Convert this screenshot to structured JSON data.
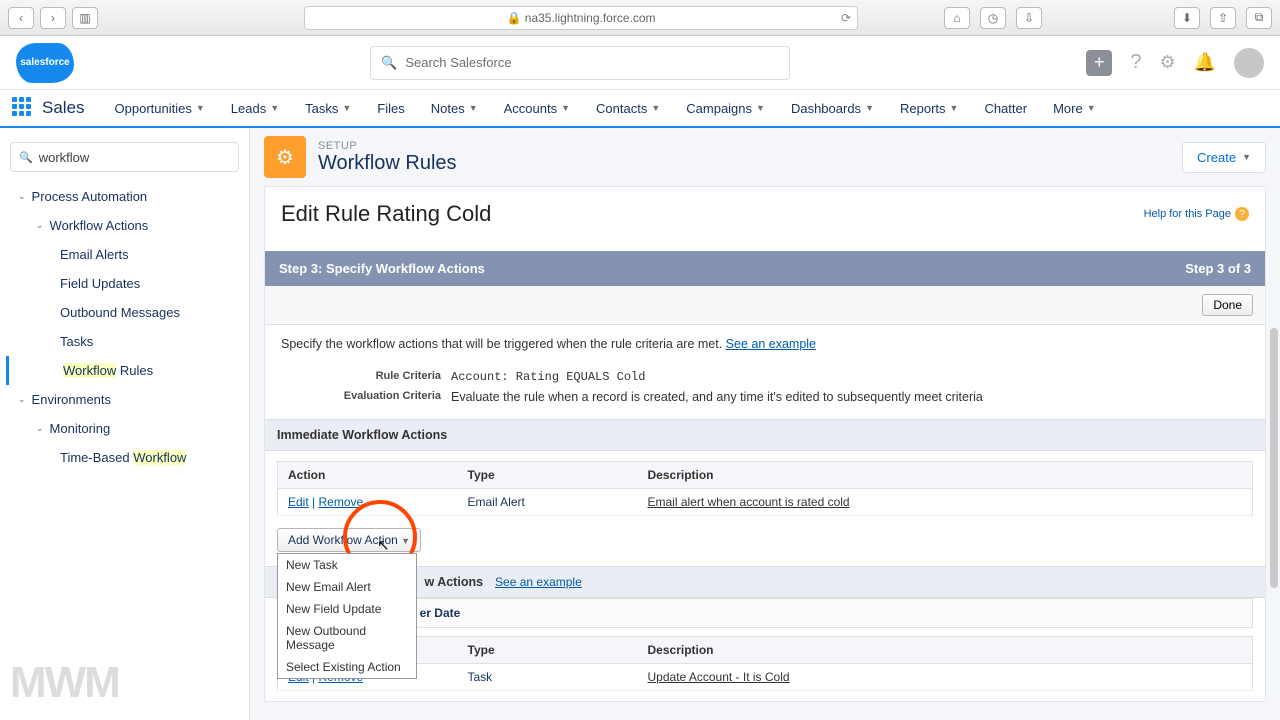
{
  "browser": {
    "url": "na35.lightning.force.com",
    "lock": "🔒"
  },
  "app": {
    "logo": "salesforce",
    "search_placeholder": "Search Salesforce",
    "name": "Sales"
  },
  "nav": [
    "Opportunities",
    "Leads",
    "Tasks",
    "Files",
    "Notes",
    "Accounts",
    "Contacts",
    "Campaigns",
    "Dashboards",
    "Reports",
    "Chatter",
    "More"
  ],
  "nav_chev": [
    true,
    true,
    true,
    false,
    true,
    true,
    true,
    true,
    true,
    true,
    false,
    true
  ],
  "sidebar": {
    "search": "workflow",
    "tree": [
      {
        "label": "Process Automation",
        "level": 0,
        "expand": true
      },
      {
        "label": "Workflow Actions",
        "level": 1,
        "expand": true
      },
      {
        "label": "Email Alerts",
        "level": 2
      },
      {
        "label": "Field Updates",
        "level": 2
      },
      {
        "label": "Outbound Messages",
        "level": 2
      },
      {
        "label": "Tasks",
        "level": 2
      },
      {
        "label": "Workflow Rules",
        "level": 2,
        "active": true,
        "hl": "Workflow"
      },
      {
        "label": "Environments",
        "level": 0,
        "expand": true
      },
      {
        "label": "Monitoring",
        "level": 1,
        "expand": true
      },
      {
        "label": "Time-Based Workflow",
        "level": 2,
        "hl": "Workflow"
      }
    ]
  },
  "page": {
    "eyebrow": "SETUP",
    "title": "Workflow Rules",
    "create": "Create",
    "rule_title": "Edit Rule Rating Cold",
    "help": "Help for this Page",
    "step_left": "Step 3: Specify Workflow Actions",
    "step_right": "Step 3 of 3",
    "done": "Done",
    "intro": "Specify the workflow actions that will be triggered when the rule criteria are met. ",
    "intro_link": "See an example",
    "rule_criteria_label": "Rule Criteria",
    "rule_criteria_value": "Account: Rating EQUALS Cold",
    "eval_criteria_label": "Evaluation Criteria",
    "eval_criteria_value": "Evaluate the rule when a record is created, and any time it's edited to subsequently meet criteria",
    "immediate_hdr": "Immediate Workflow Actions",
    "cols": {
      "action": "Action",
      "type": "Type",
      "description": "Description"
    },
    "row1": {
      "edit": "Edit",
      "remove": "Remove",
      "type": "Email Alert",
      "desc": "Email alert when account is rated cold"
    },
    "add_btn": "Add Workflow Action",
    "dropdown": [
      "New Task",
      "New Email Alert",
      "New Field Update",
      "New Outbound Message",
      "Select Existing Action"
    ],
    "time_hdr": "Time-Dependent Workflow Actions",
    "time_link": "See an example",
    "trigger": "1 Days After Rule Trigger Date",
    "row2": {
      "edit": "Edit",
      "remove": "Remove",
      "type": "Task",
      "desc": "Update Account - It is Cold"
    }
  },
  "watermark": "MWM"
}
